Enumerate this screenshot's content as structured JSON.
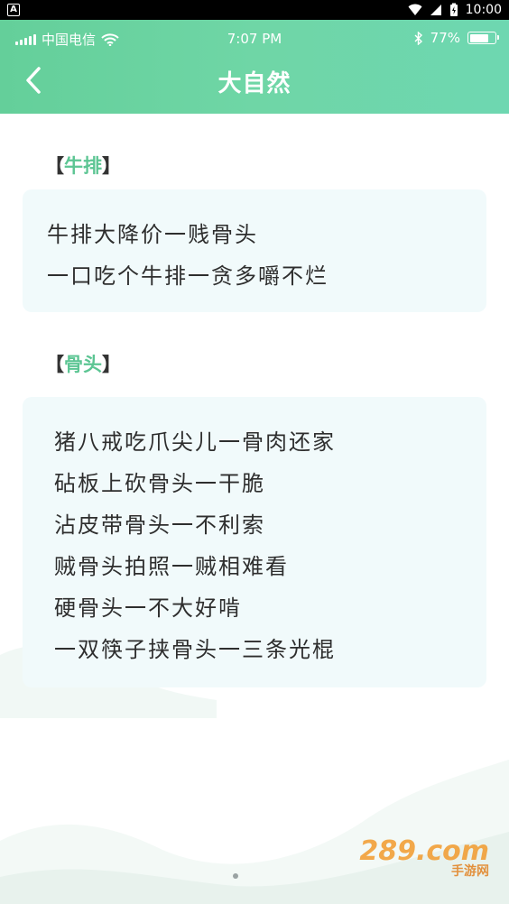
{
  "android_status": {
    "badge": "A",
    "time": "10:00"
  },
  "ios_status": {
    "carrier": "中国电信",
    "time": "7:07 PM",
    "battery": "77%",
    "battery_level": 0.77
  },
  "nav": {
    "title": "大自然"
  },
  "sections": [
    {
      "open": "【",
      "keyword": "牛排",
      "close": "】",
      "lines": [
        "牛排大降价一贱骨头",
        "一口吃个牛排一贪多嚼不烂"
      ]
    },
    {
      "open": "【",
      "keyword": "骨头",
      "close": "】",
      "lines": [
        "猪八戒吃爪尖儿一骨肉还家",
        "砧板上砍骨头一干脆",
        "沾皮带骨头一不利索",
        "贼骨头拍照一贼相难看",
        "硬骨头一不大好啃",
        "一双筷子挟骨头一三条光棍"
      ]
    }
  ],
  "watermark": {
    "main": "289.com",
    "sub": "手游网"
  },
  "colors": {
    "header_start": "#64cf9a",
    "header_end": "#6ed7b1",
    "keyword": "#5cc593",
    "card_bg": "#f1fafb"
  }
}
